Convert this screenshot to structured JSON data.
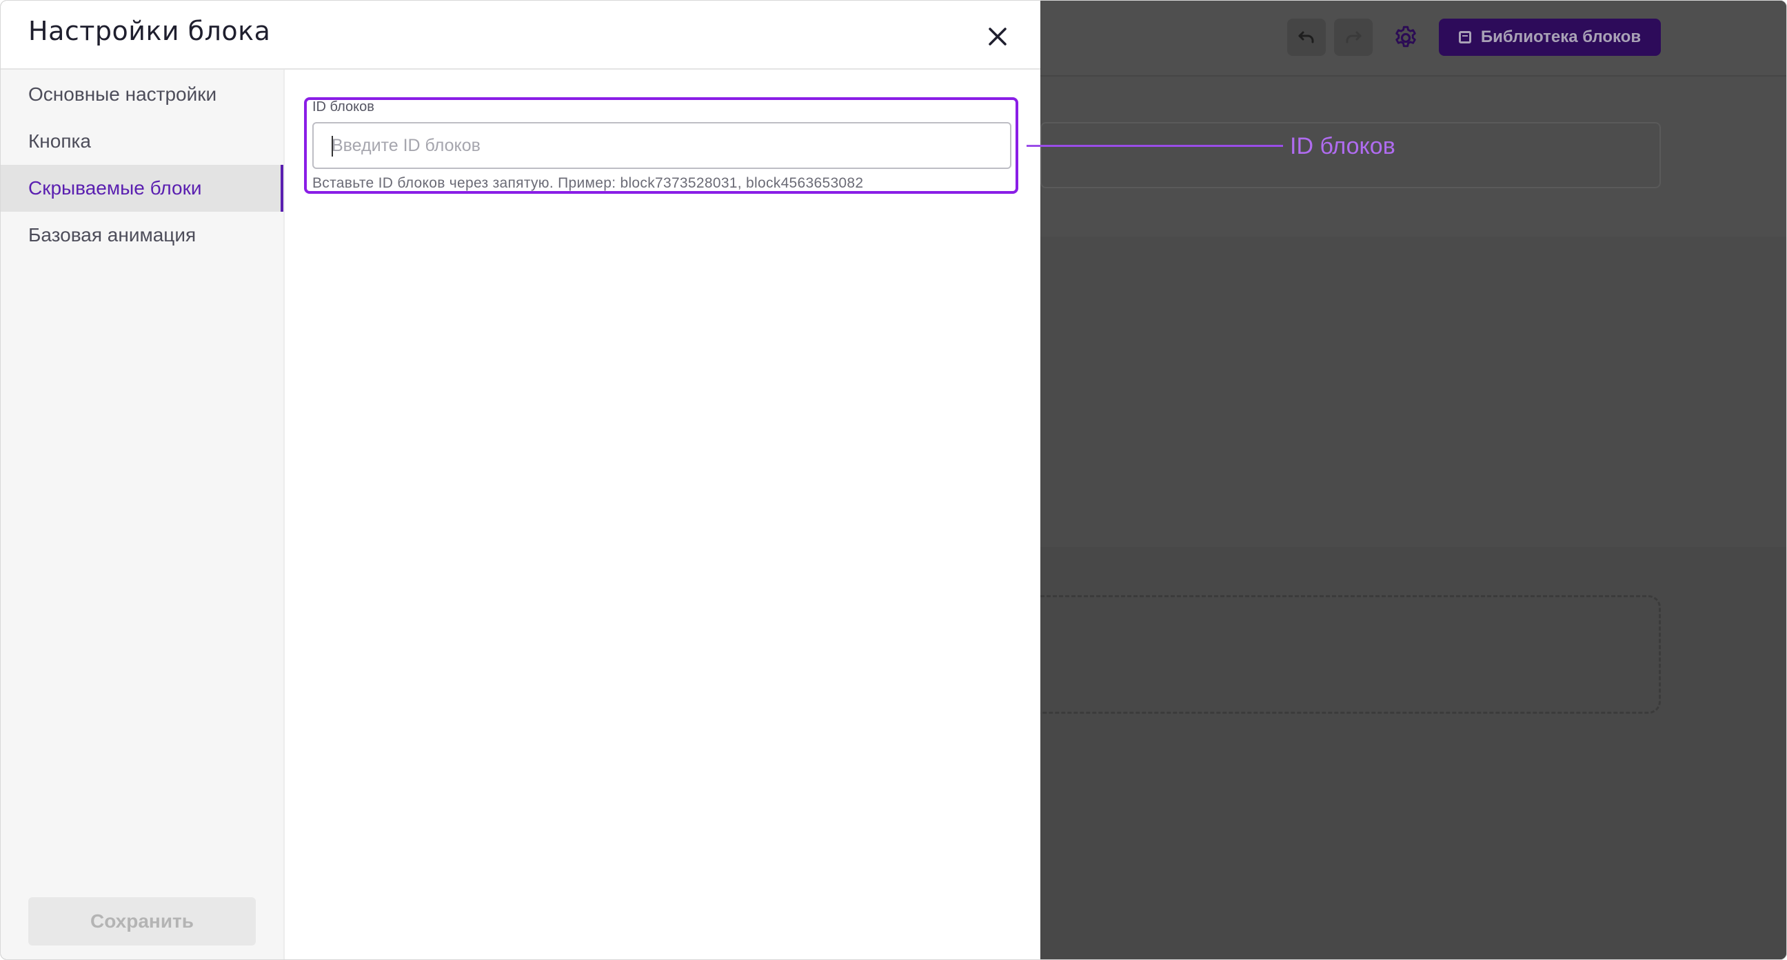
{
  "modal": {
    "title": "Настройки блока",
    "close_icon": "close-icon",
    "sidebar": {
      "items": [
        {
          "label": "Основные настройки",
          "active": false
        },
        {
          "label": "Кнопка",
          "active": false
        },
        {
          "label": "Скрываемые блоки",
          "active": true
        },
        {
          "label": "Базовая анимация",
          "active": false
        }
      ],
      "save_label": "Сохранить"
    },
    "field": {
      "label": "ID блоков",
      "placeholder": "Введите ID блоков",
      "value": "",
      "hint": "Вставьте ID блоков через запятую. Пример: block7373528031, block4563653082"
    }
  },
  "callout": {
    "label": "ID блоков"
  },
  "toolbar": {
    "undo_icon": "undo-icon",
    "redo_icon": "redo-icon",
    "settings_icon": "gear-icon",
    "library_label": "Библиотека блоков",
    "library_icon": "image-icon"
  },
  "colors": {
    "accent": "#5a1fb0",
    "highlight": "#8a1ee6",
    "callout": "#b06cf0",
    "overlay": "#4a4a4a"
  }
}
